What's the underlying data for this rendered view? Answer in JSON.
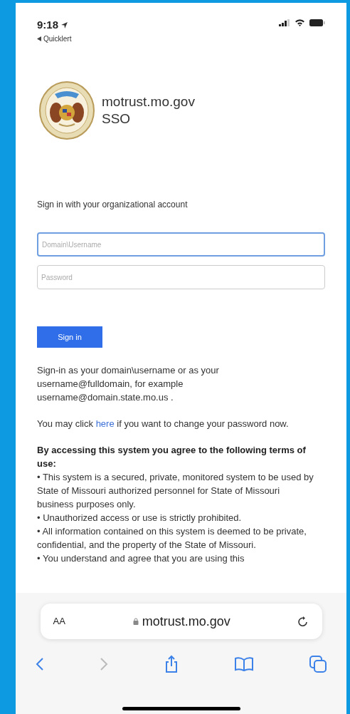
{
  "status_bar": {
    "time": "9:18",
    "back_app": "Quicklert"
  },
  "header": {
    "title": "motrust.mo.gov",
    "subtitle": "SSO"
  },
  "form": {
    "heading": "Sign in with your organizational account",
    "fields": [
      {
        "placeholder": "Domain\\Username",
        "focused": true
      },
      {
        "placeholder": "Password",
        "focused": false
      }
    ],
    "submit": "Sign in"
  },
  "help": {
    "sign_in_hint": "Sign-in as your domain\\username or as your username@fulldomain, for example username@domain.state.mo.us .",
    "password_before": "You may click",
    "password_link": "here",
    "password_after": "if you want to change your password now."
  },
  "terms": {
    "heading": "By accessing this system you agree to the following terms of use:",
    "items": [
      "• This system is a secured, private, monitored system to be used by State of Missouri authorized personnel for State of Missouri business purposes only.",
      "• Unauthorized access or use is strictly prohibited.",
      "• All information contained on this system is deemed to be private, confidential, and the property of the State of Missouri.",
      "• You understand and agree that you are using this"
    ]
  },
  "browser": {
    "text_size": "AA",
    "address": "motrust.mo.gov",
    "back_enabled": true,
    "forward_enabled": false
  }
}
